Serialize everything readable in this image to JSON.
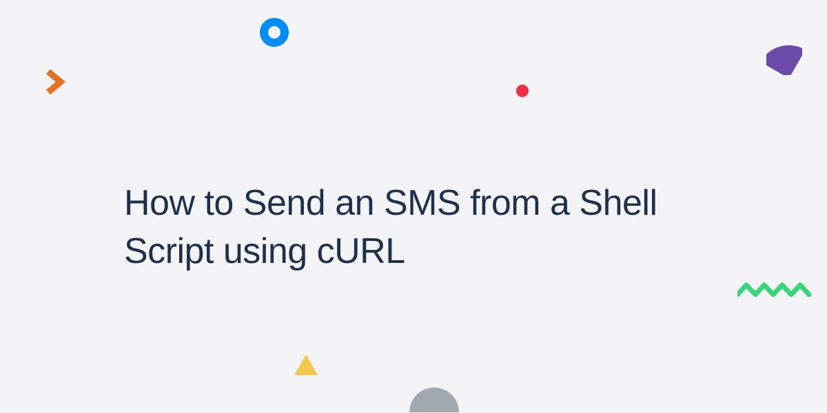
{
  "title": "How to Send an SMS from a Shell Script using cURL",
  "colors": {
    "background": "#f4f4f6",
    "text": "#1f304c",
    "accent_blue": "#008cff",
    "accent_orange": "#e86f24",
    "accent_red": "#f22f46",
    "accent_purple": "#6a4ba7",
    "accent_yellow": "#f2c94c",
    "accent_green": "#36d576",
    "accent_gray": "#a0a8b0"
  },
  "shapes": [
    {
      "name": "blue-ring",
      "type": "ring"
    },
    {
      "name": "orange-chevron",
      "type": "chevron-right"
    },
    {
      "name": "red-dot",
      "type": "dot"
    },
    {
      "name": "purple-quarter",
      "type": "quarter-circle"
    },
    {
      "name": "yellow-triangle",
      "type": "triangle"
    },
    {
      "name": "gray-half",
      "type": "half-circle"
    },
    {
      "name": "green-zigzag",
      "type": "zigzag"
    }
  ]
}
